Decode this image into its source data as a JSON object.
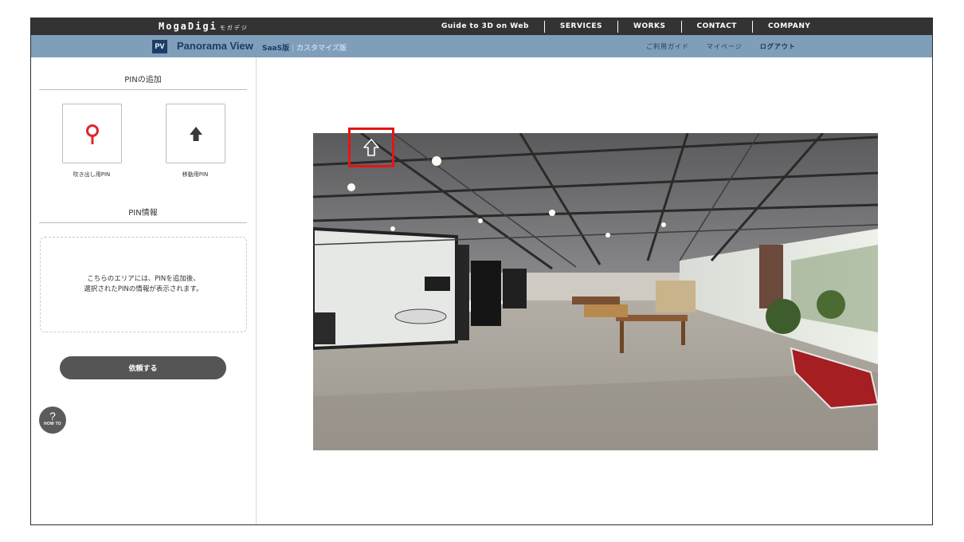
{
  "header": {
    "brand": "MogaDigi",
    "brand_kana": "モガデジ",
    "nav": [
      "Guide to 3D on Web",
      "SERVICES",
      "WORKS",
      "CONTACT",
      "COMPANY"
    ]
  },
  "subheader": {
    "badge": "PV",
    "title": "Panorama View",
    "edition": "SaaS版",
    "edition_custom": "カスタマイズ版",
    "links": [
      "ご利用ガイド",
      "マイページ",
      "ログアウト"
    ]
  },
  "sidebar": {
    "add_pin_title": "PINの追加",
    "pins": [
      {
        "label": "吹き出し用PIN",
        "icon": "map-pin-icon"
      },
      {
        "label": "移動用PIN",
        "icon": "arrow-up-icon"
      }
    ],
    "pin_info_title": "PIN情報",
    "info_line1": "こちらのエリアには、PINを追加後、",
    "info_line2": "選択されたPINの情報が表示されます。",
    "request_button": "依頼する",
    "howto_symbol": "?",
    "howto_label": "HOW TO"
  },
  "viewer": {
    "pin_icon": "move-arrow-icon",
    "marker_color": "#e61414"
  },
  "colors": {
    "topbar": "#333333",
    "subbar": "#7f9eb9",
    "accent_navy": "#1b3d66",
    "pin_red": "#e0242a"
  }
}
